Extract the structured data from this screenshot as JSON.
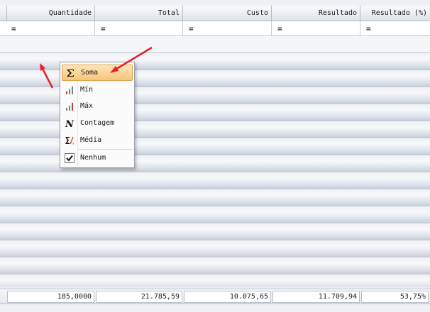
{
  "columns": [
    {
      "key": "quantidade",
      "label": "Quantidade",
      "filter": "=",
      "total": "185,0000"
    },
    {
      "key": "total",
      "label": "Total",
      "filter": "=",
      "total": "21.785,59"
    },
    {
      "key": "custo",
      "label": "Custo",
      "filter": "=",
      "total": "10.075,65"
    },
    {
      "key": "resultado",
      "label": "Resultado",
      "filter": "=",
      "total": "11.709,94"
    },
    {
      "key": "resultado_pct",
      "label": "Resultado (%)",
      "filter": "=",
      "total": "53,75%"
    }
  ],
  "first_column": {
    "filter": "="
  },
  "context_menu": {
    "items": [
      {
        "label": "Soma",
        "icon": "sigma-icon",
        "highlighted": true
      },
      {
        "label": "Mín",
        "icon": "bar-chart-min-icon"
      },
      {
        "label": "Máx",
        "icon": "bar-chart-max-icon"
      },
      {
        "label": "Contagem",
        "icon": "count-n-icon"
      },
      {
        "label": "Média",
        "icon": "average-icon"
      },
      {
        "label": "Nenhum",
        "icon": "checkbox-checked-icon",
        "checked": true
      }
    ]
  },
  "colors": {
    "highlight": "#f7c57a",
    "arrow": "#e8202a",
    "header": "#dfe3ea"
  }
}
